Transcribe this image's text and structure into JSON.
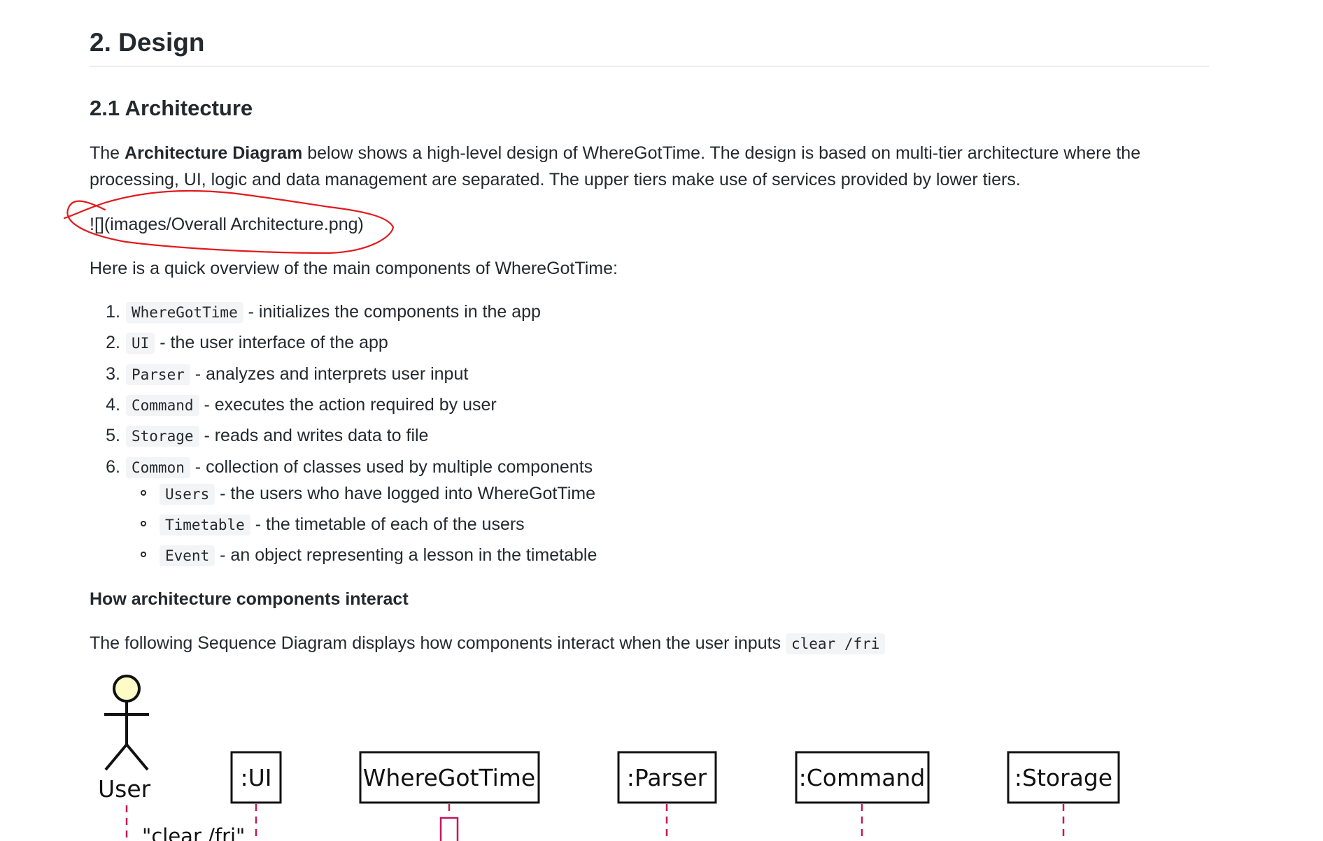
{
  "heading": "2. Design",
  "subheading": "2.1 Architecture",
  "intro": {
    "prefix": "The ",
    "bold": "Architecture Diagram",
    "line1_rest": " below shows a high-level design of WhereGotTime. The design is based on multi-tier architecture where the",
    "line2": "processing, UI, logic and data management are separated. The upper tiers make use of services provided by lower tiers."
  },
  "broken_image_text": "![](images/Overall Architecture.png)",
  "overview_text": "Here is a quick overview of the main components of WhereGotTime:",
  "components": [
    {
      "num": "1.",
      "code": "WhereGotTime",
      "desc": " - initializes the components in the app"
    },
    {
      "num": "2.",
      "code": "UI",
      "desc": " - the user interface of the app"
    },
    {
      "num": "3.",
      "code": "Parser",
      "desc": " - analyzes and interprets user input"
    },
    {
      "num": "4.",
      "code": "Command",
      "desc": " - executes the action required by user"
    },
    {
      "num": "5.",
      "code": "Storage",
      "desc": " - reads and writes data to file"
    },
    {
      "num": "6.",
      "code": "Common",
      "desc": " - collection of classes used by multiple components"
    }
  ],
  "common_items": [
    {
      "code": "Users",
      "desc": " - the users who have logged into WhereGotTime"
    },
    {
      "code": "Timetable",
      "desc": " - the timetable of each of the users"
    },
    {
      "code": "Event",
      "desc": " - an object representing a lesson in the timetable"
    }
  ],
  "interact_heading": "How architecture components interact",
  "sequence_text": "The following Sequence Diagram displays how components interact when the user inputs ",
  "sequence_code": "clear /fri",
  "diagram": {
    "actor_label": "User",
    "participants": [
      ":UI",
      "WhereGotTime",
      ":Parser",
      ":Command",
      ":Storage"
    ],
    "first_message": "\"clear /fri\""
  },
  "colors": {
    "annotation": "#e3191c",
    "lifeline": "#c2185b",
    "actor_fill": "#fdfbc6"
  }
}
